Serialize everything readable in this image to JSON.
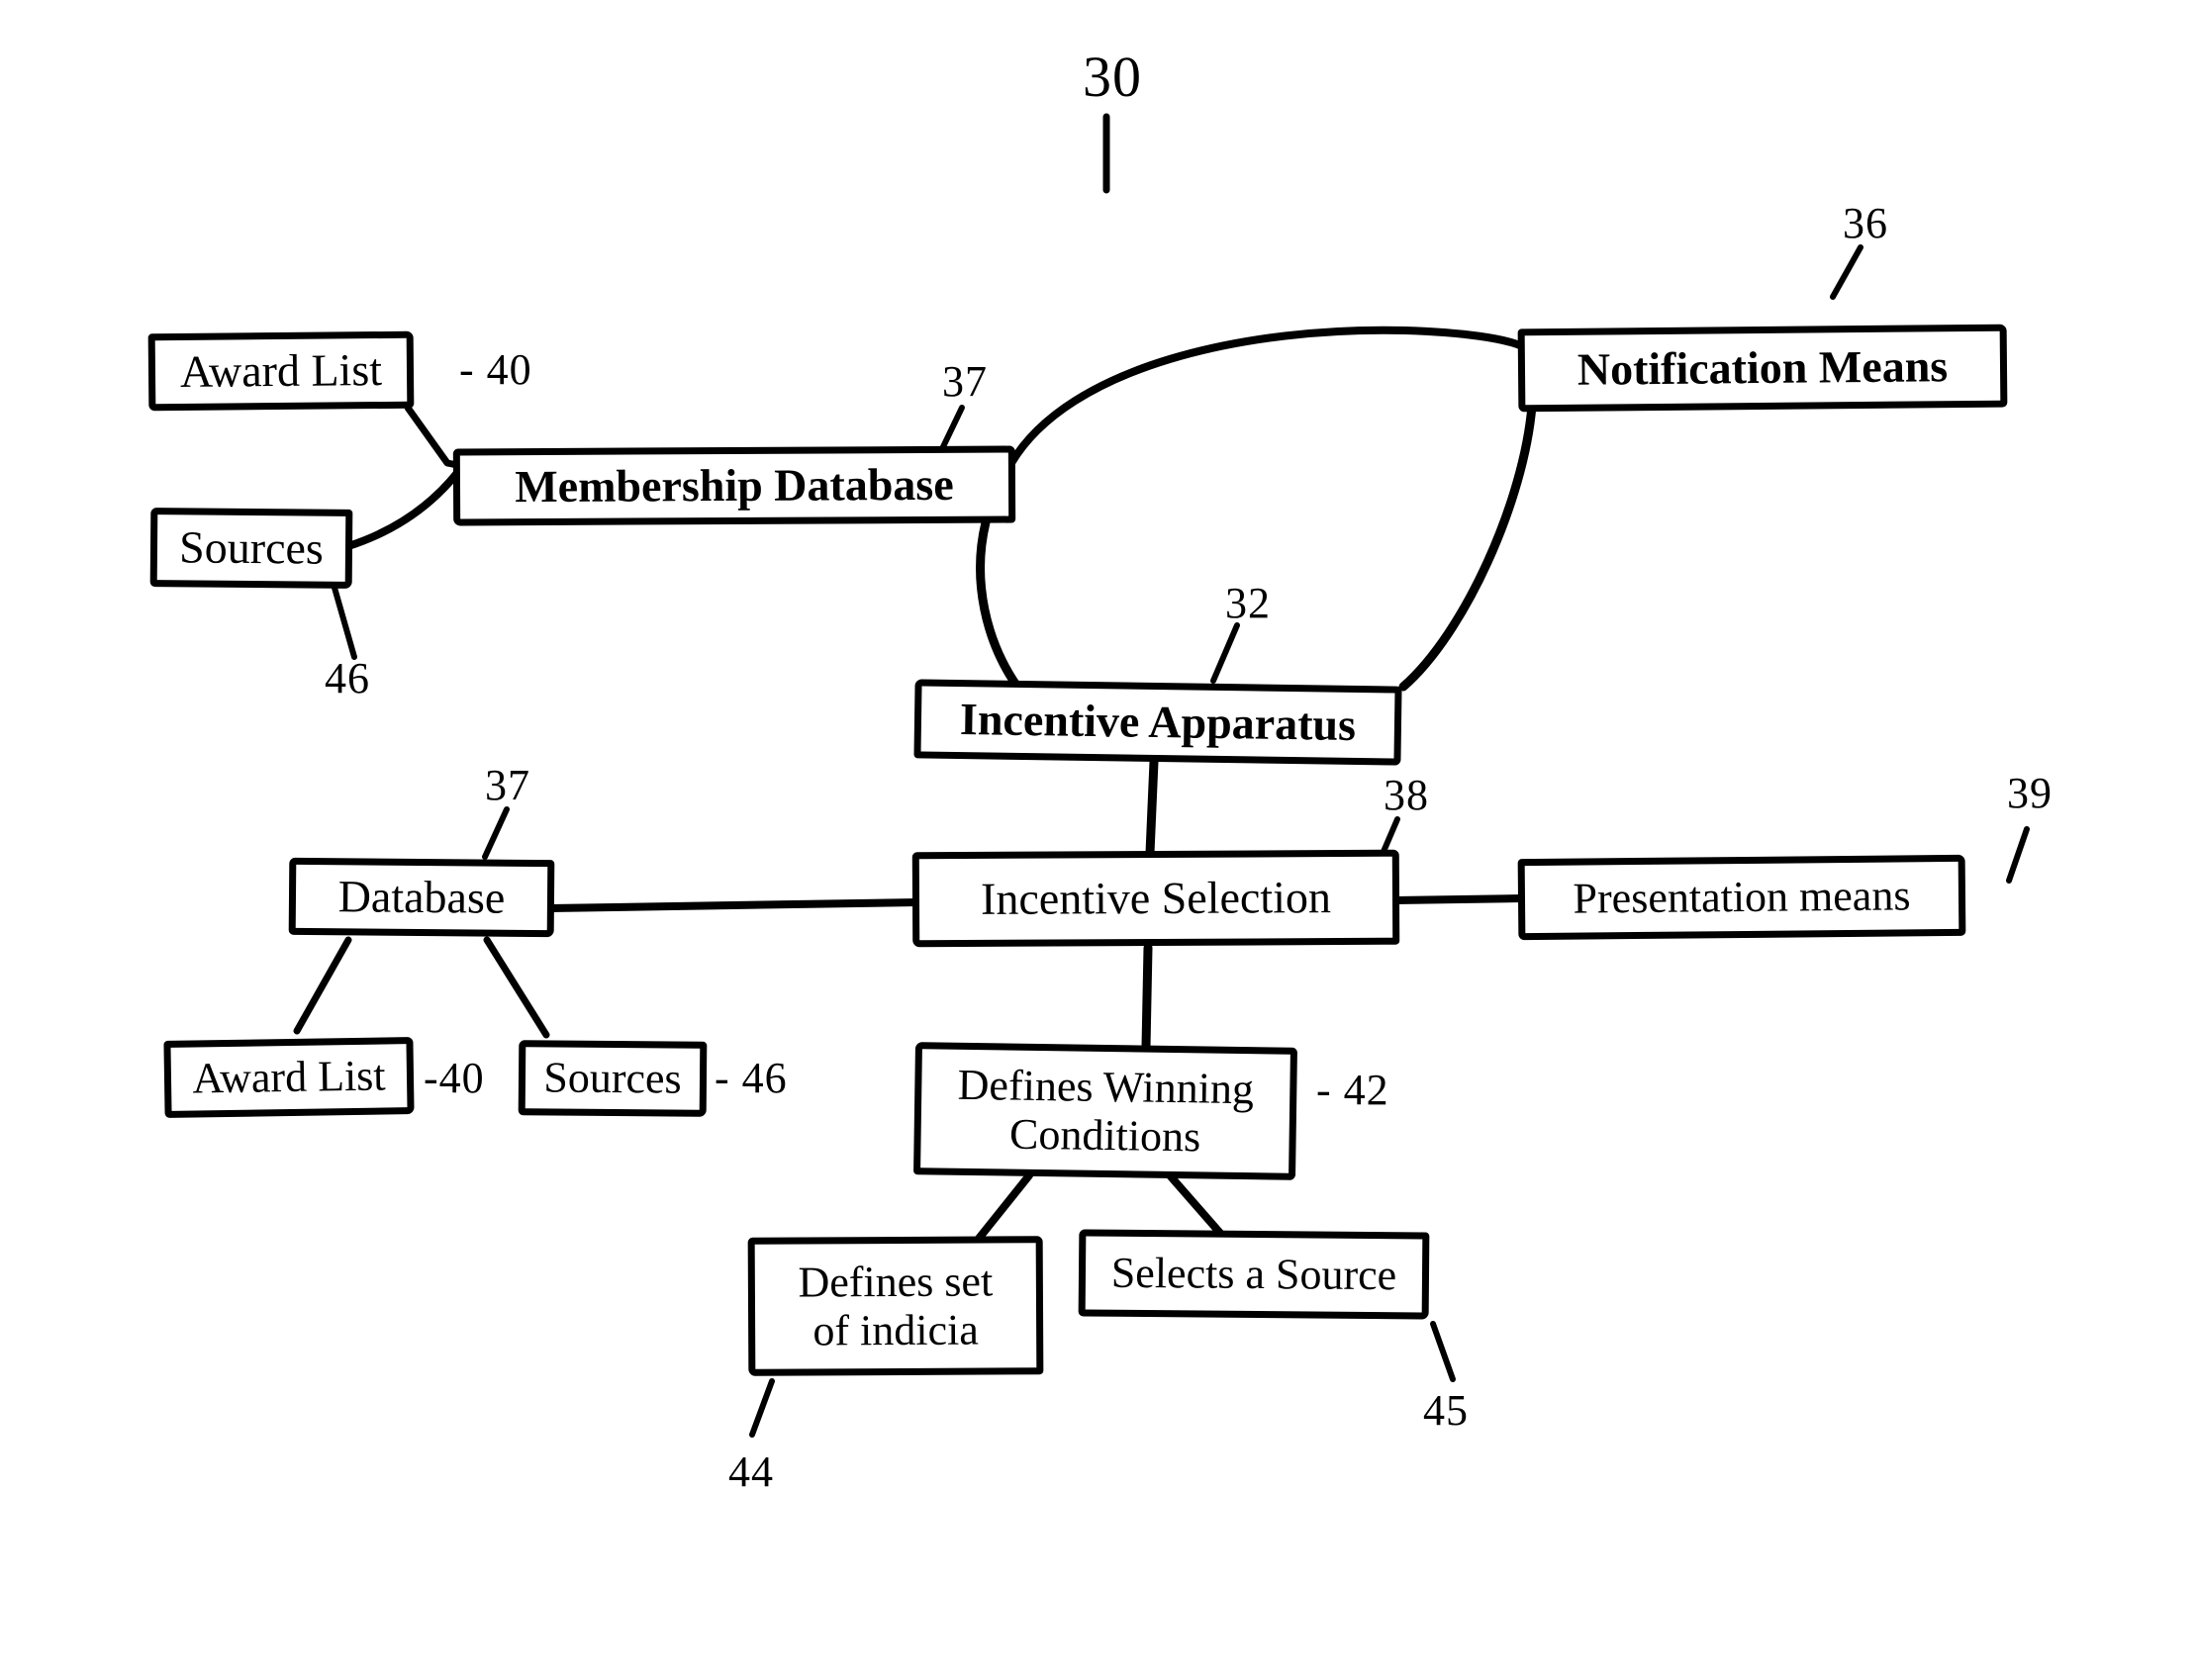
{
  "figure": {
    "title_numeral": "30",
    "style": "patent-block-diagram",
    "ink_color": "#000000",
    "background": "#ffffff"
  },
  "nodes": [
    {
      "id": "award_list_top",
      "label": "Award List",
      "bold": false
    },
    {
      "id": "sources_top",
      "label": "Sources",
      "bold": false
    },
    {
      "id": "membership_database",
      "label": "Membership Database",
      "bold": true
    },
    {
      "id": "notification_means",
      "label": "Notification Means",
      "bold": true
    },
    {
      "id": "incentive_apparatus",
      "label": "Incentive Apparatus",
      "bold": true
    },
    {
      "id": "database",
      "label": "Database",
      "bold": false
    },
    {
      "id": "incentive_selection",
      "label": "Incentive Selection",
      "bold": false
    },
    {
      "id": "presentation_means",
      "label": "Presentation means",
      "bold": false
    },
    {
      "id": "award_list_bottom",
      "label": "Award List",
      "bold": false
    },
    {
      "id": "sources_bottom",
      "label": "Sources",
      "bold": false
    },
    {
      "id": "defines_winning",
      "line1": "Defines Winning",
      "line2": "Conditions",
      "bold": false
    },
    {
      "id": "defines_indicia",
      "line1": "Defines set",
      "line2": "of indicia",
      "bold": false
    },
    {
      "id": "selects_source",
      "label": "Selects a Source",
      "bold": false
    }
  ],
  "labels": {
    "fig_30": "30",
    "ref_36": "36",
    "ref_37_top": "37",
    "ref_40_top": "- 40",
    "ref_46_top": "46",
    "ref_32": "32",
    "ref_37_mid": "37",
    "ref_38": "38",
    "ref_39": "39",
    "ref_40_bottom": "-40",
    "ref_46_bottom": "- 46",
    "ref_42": "- 42",
    "ref_44": "44",
    "ref_45": "45"
  },
  "connections": [
    {
      "from": "award_list_top",
      "to": "membership_database"
    },
    {
      "from": "sources_top",
      "to": "membership_database"
    },
    {
      "from": "membership_database",
      "to": "notification_means"
    },
    {
      "from": "membership_database",
      "to": "incentive_apparatus"
    },
    {
      "from": "notification_means",
      "to": "incentive_apparatus"
    },
    {
      "from": "incentive_apparatus",
      "to": "incentive_selection"
    },
    {
      "from": "database",
      "to": "incentive_selection"
    },
    {
      "from": "incentive_selection",
      "to": "presentation_means"
    },
    {
      "from": "database",
      "to": "award_list_bottom"
    },
    {
      "from": "database",
      "to": "sources_bottom"
    },
    {
      "from": "incentive_selection",
      "to": "defines_winning"
    },
    {
      "from": "defines_winning",
      "to": "defines_indicia"
    },
    {
      "from": "defines_winning",
      "to": "selects_source"
    }
  ]
}
